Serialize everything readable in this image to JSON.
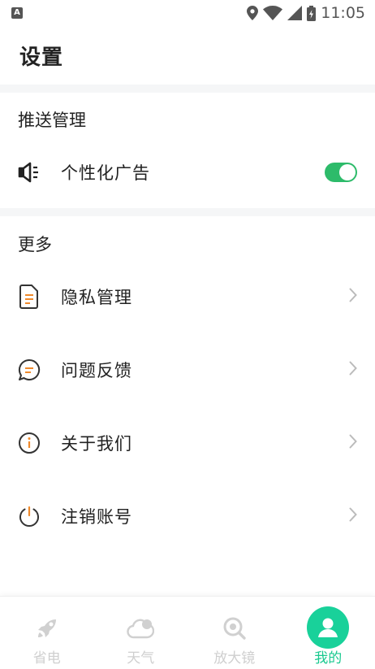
{
  "status_bar": {
    "left_badge": "A",
    "time": "11:05",
    "icons": [
      "location-icon",
      "wifi-icon",
      "signal-icon",
      "battery-charging-icon"
    ]
  },
  "page": {
    "title": "设置"
  },
  "sections": {
    "push": {
      "header": "推送管理",
      "items": [
        {
          "label": "个性化广告",
          "icon": "megaphone-icon",
          "toggle_on": true
        }
      ]
    },
    "more": {
      "header": "更多",
      "items": [
        {
          "label": "隐私管理",
          "icon": "document-icon"
        },
        {
          "label": "问题反馈",
          "icon": "chat-bubble-icon"
        },
        {
          "label": "关于我们",
          "icon": "info-icon"
        },
        {
          "label": "注销账号",
          "icon": "power-icon"
        }
      ]
    }
  },
  "tab_bar": {
    "tabs": [
      {
        "label": "省电",
        "icon": "rocket-icon",
        "active": false
      },
      {
        "label": "天气",
        "icon": "cloud-icon",
        "active": false
      },
      {
        "label": "放大镜",
        "icon": "magnifier-icon",
        "active": false
      },
      {
        "label": "我的",
        "icon": "user-icon",
        "active": true
      }
    ]
  },
  "colors": {
    "accent": "#19d19a",
    "toggle_on": "#2dbb6a",
    "icon_orange": "#f08a2c",
    "section_gap": "#f5f6f7",
    "inactive_tab": "#cfcfcf"
  }
}
